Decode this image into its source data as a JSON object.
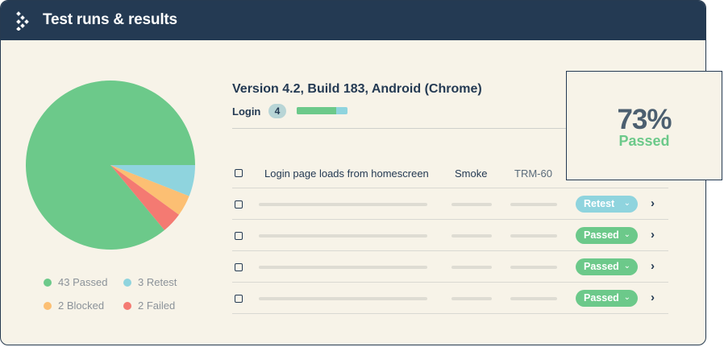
{
  "header": {
    "title": "Test runs & results"
  },
  "chart_data": {
    "type": "pie",
    "slices": [
      {
        "label": "Passed",
        "value": 43,
        "color": "#6cc98a"
      },
      {
        "label": "Retest",
        "value": 3,
        "color": "#8fd4de"
      },
      {
        "label": "Blocked",
        "value": 2,
        "color": "#fcbf73"
      },
      {
        "label": "Failed",
        "value": 2,
        "color": "#f47a72"
      }
    ]
  },
  "legend": [
    {
      "label": "43 Passed",
      "color": "#6cc98a"
    },
    {
      "label": "3 Retest",
      "color": "#8fd4de"
    },
    {
      "label": "2 Blocked",
      "color": "#fcbf73"
    },
    {
      "label": "2 Failed",
      "color": "#f47a72"
    }
  ],
  "run": {
    "title": "Version 4.2, Build 183, Android (Chrome)",
    "suite_label": "Login",
    "suite_count": "4",
    "suite_progress": 0.78
  },
  "table": {
    "header": {
      "title": "Login page loads from homescreen",
      "type": "Smoke",
      "id": "TRM-60"
    },
    "rows": [
      {
        "status": "Retest",
        "status_color": "#8fd4de"
      },
      {
        "status": "Passed",
        "status_color": "#6cc98a"
      },
      {
        "status": "Passed",
        "status_color": "#6cc98a"
      },
      {
        "status": "Passed",
        "status_color": "#6cc98a"
      }
    ]
  },
  "summary": {
    "percent": "73%",
    "label": "Passed"
  },
  "icons": {
    "logo": "testrail-logo-icon",
    "caret": "chevron-down-icon",
    "row_arrow": "chevron-right-icon"
  }
}
